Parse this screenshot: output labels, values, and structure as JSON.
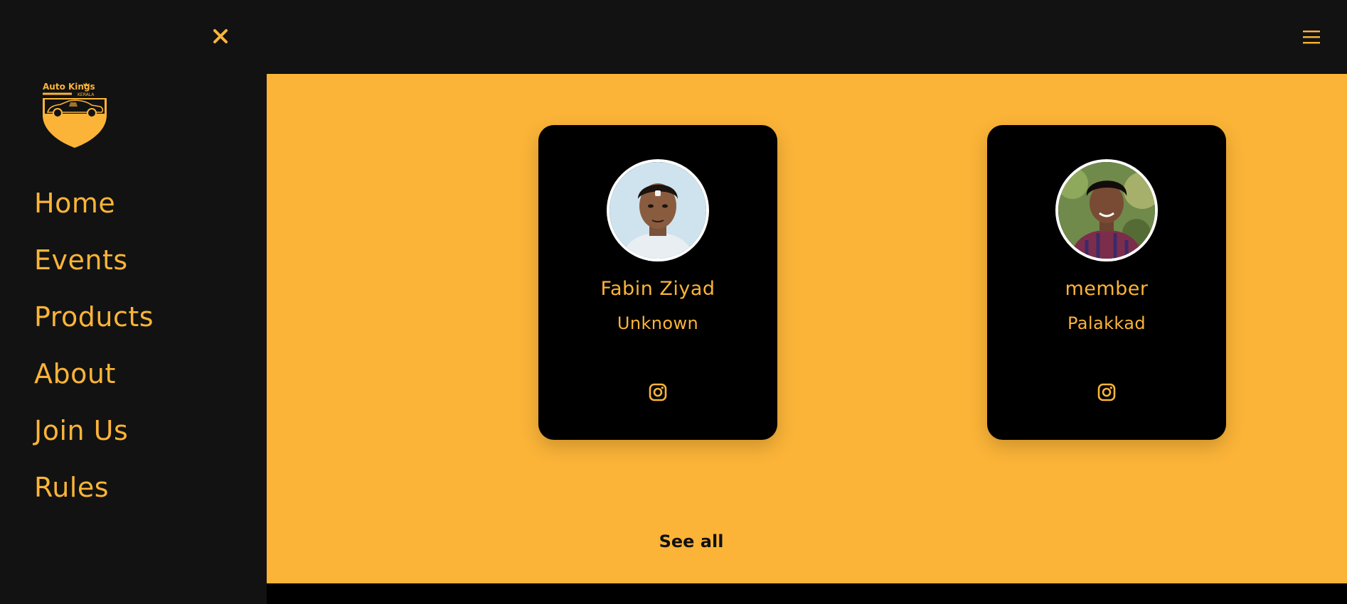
{
  "header": {
    "close_icon": "close-icon",
    "menu_icon": "hamburger-menu-icon"
  },
  "sidebar": {
    "logo": {
      "text_top": "Auto Kings",
      "text_bottom": "KERALA"
    },
    "items": [
      {
        "label": "Home"
      },
      {
        "label": "Events"
      },
      {
        "label": "Products"
      },
      {
        "label": "About"
      },
      {
        "label": "Join Us"
      },
      {
        "label": "Rules"
      }
    ]
  },
  "members": [
    {
      "name": "Fabin Ziyad",
      "location": "Unknown",
      "social_icon": "instagram-icon"
    },
    {
      "name": "member",
      "location": "Palakkad",
      "social_icon": "instagram-icon"
    }
  ],
  "see_all_label": "See all",
  "colors": {
    "accent": "#fbb438",
    "dark": "#121212",
    "card": "#000000"
  }
}
